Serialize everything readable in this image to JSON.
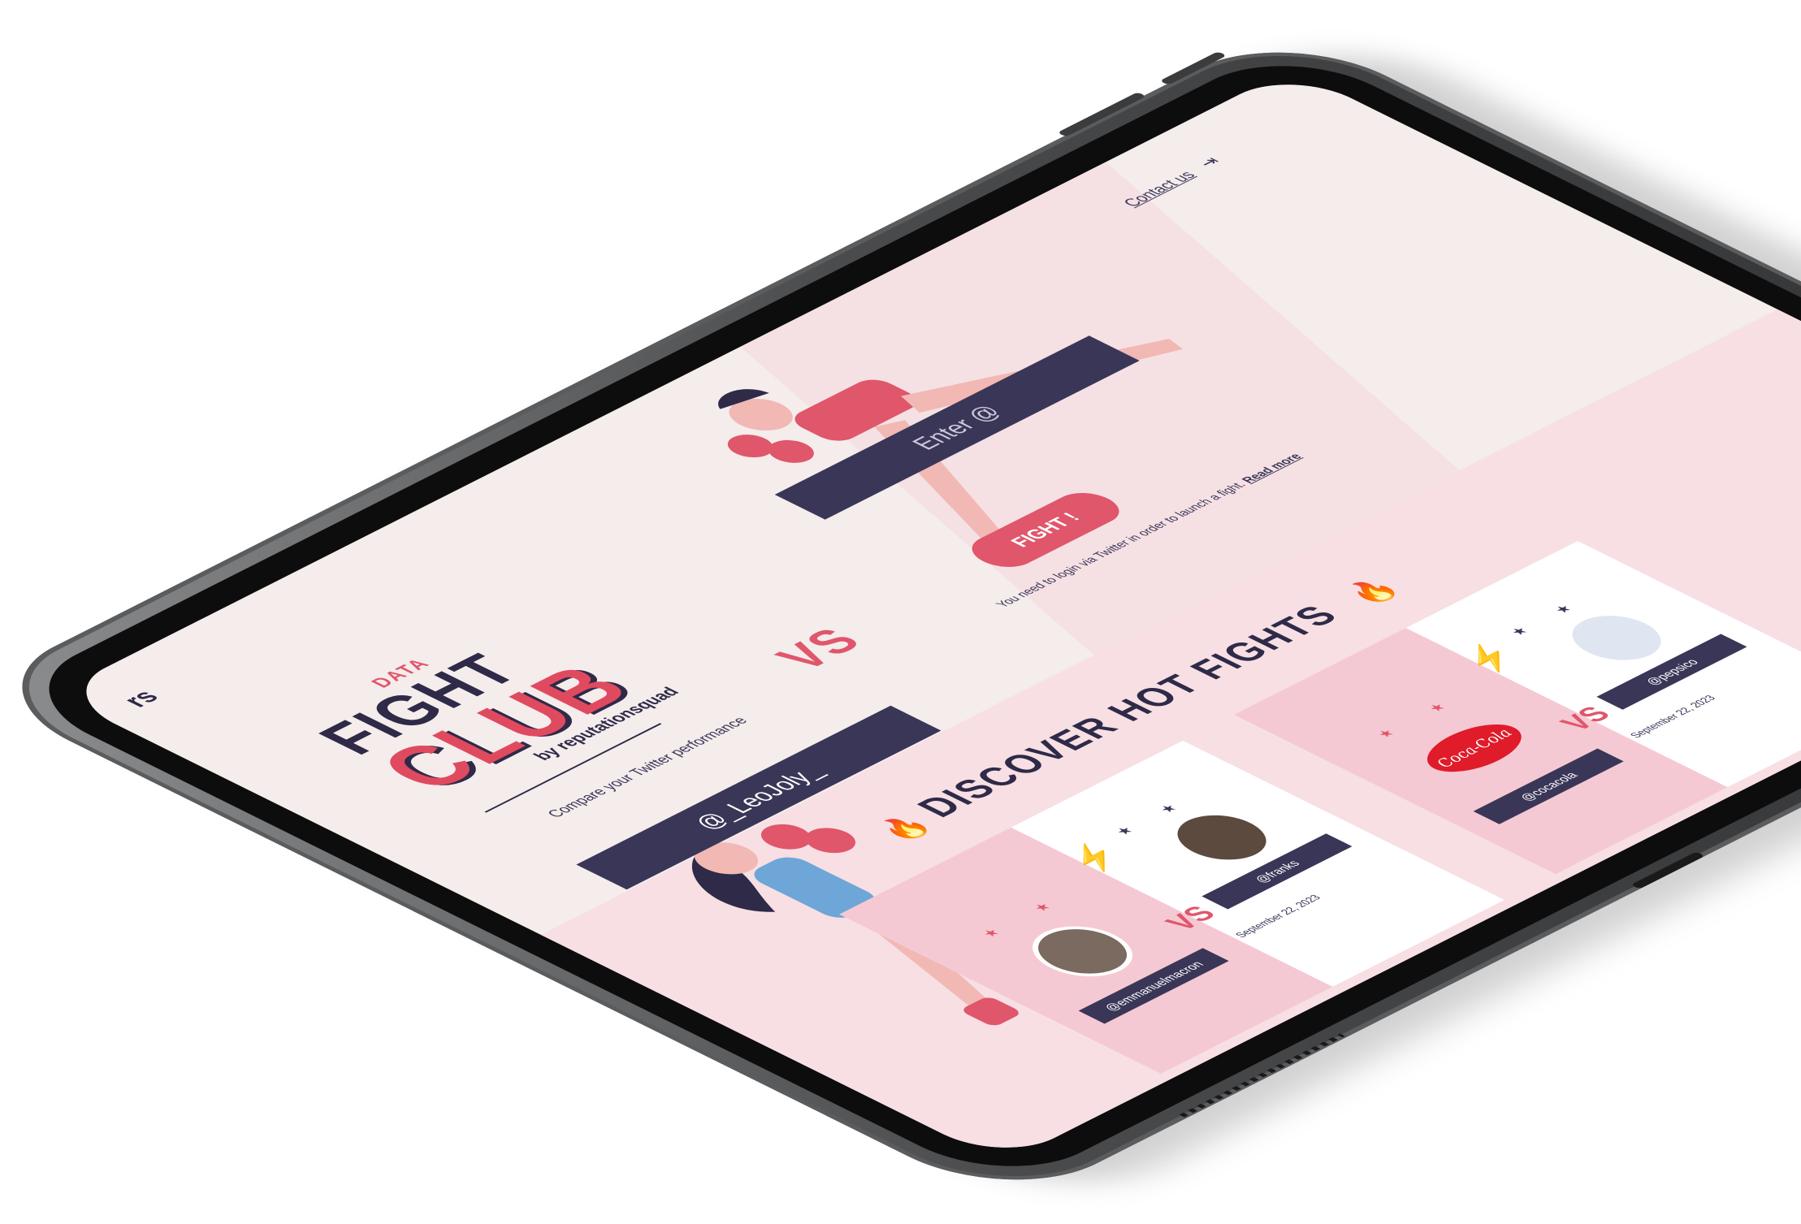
{
  "header": {
    "contact_label": "Contact us",
    "logout_icon": "logout-icon",
    "corner_text": "rs"
  },
  "logo": {
    "data": "DATA",
    "fight": "FIGHT",
    "club": "CLUB",
    "by": "by reputationsquad"
  },
  "tagline": "Compare your Twitter performance",
  "challenge": {
    "left_handle": "@_LeoJoly_",
    "right_placeholder": "Enter @",
    "vs_label": "VS",
    "fight_button": "FIGHT !",
    "login_note": "You need to login via Twitter in order to launch a fight.",
    "read_more": "Read more"
  },
  "hot_fights": {
    "title": "DISCOVER HOT FIGHTS",
    "cards": [
      {
        "left_handle": "@emmanuelmacron",
        "right_handle": "@franks",
        "vs": "VS",
        "date": "September 22, 2023"
      },
      {
        "left_handle": "@cocacola",
        "right_handle": "@pepsico",
        "vs": "VS",
        "date": "September 22, 2023"
      }
    ]
  },
  "colors": {
    "accent": "#e0566b",
    "navy": "#3a3657",
    "background": "#f5ecec"
  }
}
